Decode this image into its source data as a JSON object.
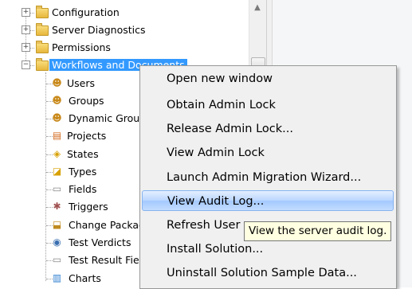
{
  "tree": {
    "items": [
      {
        "label": "Configuration",
        "icon": "folder-icon",
        "expander": "+"
      },
      {
        "label": "Server Diagnostics",
        "icon": "folder-icon",
        "expander": "+"
      },
      {
        "label": "Permissions",
        "icon": "folder-icon",
        "expander": "+"
      },
      {
        "label": "Workflows and Documents",
        "icon": "folder-icon",
        "expander": "−",
        "selected": true
      },
      {
        "label": "Users",
        "icon": "user-icon"
      },
      {
        "label": "Groups",
        "icon": "group-icon"
      },
      {
        "label": "Dynamic Groups",
        "icon": "dynamic-group-icon"
      },
      {
        "label": "Projects",
        "icon": "projects-icon"
      },
      {
        "label": "States",
        "icon": "states-icon"
      },
      {
        "label": "Types",
        "icon": "types-icon"
      },
      {
        "label": "Fields",
        "icon": "fields-icon"
      },
      {
        "label": "Triggers",
        "icon": "triggers-icon"
      },
      {
        "label": "Change Packages",
        "icon": "change-packages-icon"
      },
      {
        "label": "Test Verdicts",
        "icon": "test-verdicts-icon"
      },
      {
        "label": "Test Result Fields",
        "icon": "test-result-fields-icon"
      },
      {
        "label": "Charts",
        "icon": "charts-icon"
      }
    ]
  },
  "context_menu": {
    "items": [
      {
        "label": "Open new window"
      },
      {
        "label": "Obtain Admin Lock"
      },
      {
        "label": "Release Admin Lock..."
      },
      {
        "label": "View Admin Lock"
      },
      {
        "label": "Launch Admin Migration Wizard..."
      },
      {
        "label": "View Audit Log...",
        "hover": true
      },
      {
        "label": "Refresh User"
      },
      {
        "label": "Install Solution..."
      },
      {
        "label": "Uninstall Solution Sample Data..."
      }
    ]
  },
  "tooltip": {
    "text": "View the server audit log."
  },
  "scrollbar": {
    "up_arrow": "▲"
  },
  "colors": {
    "selection": "#3399ff",
    "menu_bg": "#f0f0f0",
    "tooltip_bg": "#ffffe1",
    "hover_border": "#86b4f0"
  }
}
